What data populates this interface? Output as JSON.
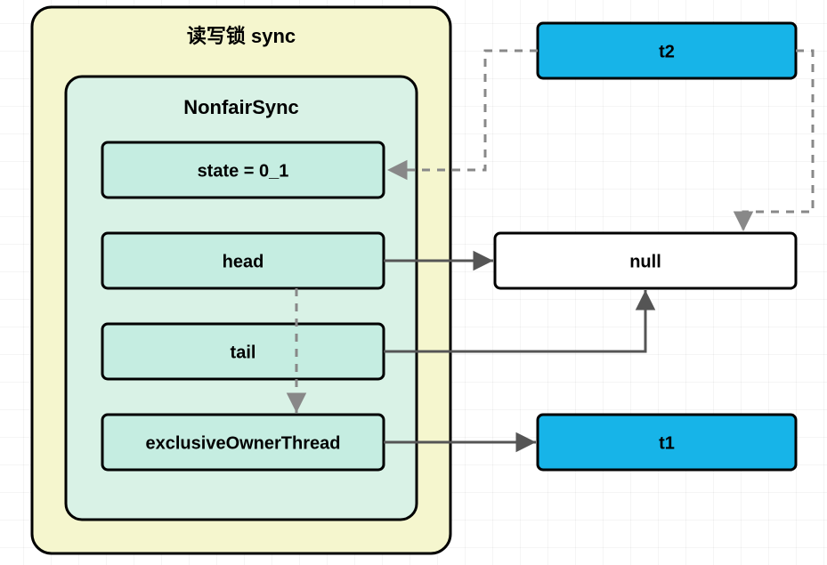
{
  "outer": {
    "title": "读写锁 sync"
  },
  "inner": {
    "title": "NonfairSync"
  },
  "fields": {
    "state": "state = 0_1",
    "head": "head",
    "tail": "tail",
    "owner": "exclusiveOwnerThread"
  },
  "nodes": {
    "t2": "t2",
    "null": "null",
    "t1": "t1"
  },
  "colors": {
    "outerFill": "#F5F6CE",
    "outerStroke": "#000000",
    "innerFill": "#D9F2E6",
    "innerStroke": "#000000",
    "fieldFill": "#C5EDE1",
    "fieldStroke": "#000000",
    "threadFill": "#17B4E8",
    "threadStroke": "#000000",
    "nullFill": "#FFFFFF",
    "nullStroke": "#000000",
    "arrow": "#555555",
    "dashed": "#888888"
  }
}
